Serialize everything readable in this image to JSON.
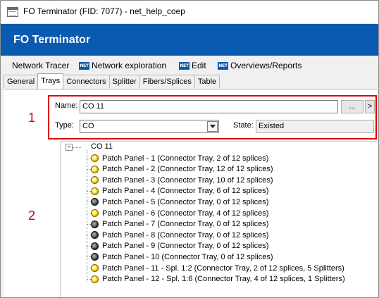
{
  "window": {
    "title": "FO Terminator (FID: 7077) - net_help_coep"
  },
  "header": {
    "title": "FO Terminator"
  },
  "menu": {
    "items": [
      {
        "label": "Network Tracer",
        "icon": ""
      },
      {
        "label": "Network exploration",
        "icon": "NET"
      },
      {
        "label": "Edit",
        "icon": "NET"
      },
      {
        "label": "Overviews/Reports",
        "icon": "NET"
      }
    ]
  },
  "tabs": [
    {
      "label": "General",
      "active": false
    },
    {
      "label": "Trays",
      "active": true
    },
    {
      "label": "Connectors",
      "active": false
    },
    {
      "label": "Splitter",
      "active": false
    },
    {
      "label": "Fibers/Splices",
      "active": false
    },
    {
      "label": "Table",
      "active": false
    }
  ],
  "annotations": {
    "one": "1",
    "two": "2"
  },
  "form": {
    "name_label": "Name:",
    "name_value": "CO 11",
    "browse_label": "...",
    "next_label": ">",
    "type_label": "Type:",
    "type_value": "CO",
    "state_label": "State:",
    "state_value": "Existed"
  },
  "tree": {
    "root": "CO 11",
    "items": [
      {
        "label": "Patch Panel - 1 (Connector Tray, 2 of 12 splices)",
        "status": "yellow"
      },
      {
        "label": "Patch Panel - 2 (Connector Tray, 12 of 12 splices)",
        "status": "yellow"
      },
      {
        "label": "Patch Panel - 3 (Connector Tray, 10 of 12 splices)",
        "status": "yellow"
      },
      {
        "label": "Patch Panel - 4 (Connector Tray, 6 of 12 splices)",
        "status": "yellow"
      },
      {
        "label": "Patch Panel - 5 (Connector Tray, 0 of 12 splices)",
        "status": "dark"
      },
      {
        "label": "Patch Panel - 6 (Connector Tray, 4 of 12 splices)",
        "status": "yellow"
      },
      {
        "label": "Patch Panel - 7 (Connector Tray, 0 of 12 splices)",
        "status": "dark"
      },
      {
        "label": "Patch Panel - 8 (Connector Tray, 0 of 12 splices)",
        "status": "dark"
      },
      {
        "label": "Patch Panel - 9 (Connector Tray, 0 of 12 splices)",
        "status": "dark"
      },
      {
        "label": "Patch Panel - 10 (Connector Tray, 0 of 12 splices)",
        "status": "dark"
      },
      {
        "label": "Patch Panel - 11 - Spl. 1:2 (Connector Tray, 2 of 12 splices, 5 Splitters)",
        "status": "yellow"
      },
      {
        "label": "Patch Panel - 12 - Spl. 1:6 (Connector Tray, 4 of 12 splices, 1 Splitters)",
        "status": "yellow"
      }
    ]
  },
  "colors": {
    "header_bg": "#0a5ab0",
    "annotation_red": "#e00000",
    "status_yellow": "#f2cc00",
    "status_dark": "#3a3a3a"
  }
}
